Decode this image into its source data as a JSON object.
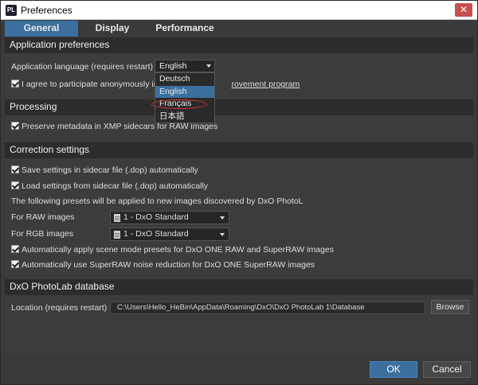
{
  "window": {
    "title": "Preferences",
    "app_icon": "PL",
    "close_symbol": "✕"
  },
  "tabs": [
    {
      "label": "General",
      "active": true
    },
    {
      "label": "Display",
      "active": false
    },
    {
      "label": "Performance",
      "active": false
    }
  ],
  "app_prefs": {
    "header": "Application preferences",
    "language_label": "Application language (requires restart)",
    "language_value": "English",
    "language_options": [
      "Deutsch",
      "English",
      "Français",
      "日本語"
    ],
    "participate_prefix": "I agree to participate anonymously in t",
    "participate_link": "rovement program"
  },
  "processing": {
    "header": "Processing",
    "preserve_metadata": "Preserve metadata in XMP sidecars for RAW images"
  },
  "correction": {
    "header": "Correction settings",
    "save_sidecar": "Save settings in sidecar file (.dop) automatically",
    "load_sidecar": "Load settings from sidecar file (.dop) automatically",
    "presets_note": "The following presets will be applied to new images discovered by DxO PhotoL",
    "raw_label": "For RAW images",
    "raw_value": "1 - DxO Standard",
    "rgb_label": "For RGB images",
    "rgb_value": "1 - DxO Standard",
    "scene_mode": "Automatically apply scene mode presets for DxO ONE RAW and SuperRAW images",
    "superraw": "Automatically use SuperRAW noise reduction for DxO ONE SuperRAW images"
  },
  "database": {
    "header": "DxO PhotoLab database",
    "location_label": "Location (requires restart)",
    "path": "C:\\Users\\Hello_HeBin\\AppData\\Roaming\\DxO\\DxO PhotoLab 1\\Database",
    "browse": "Browse"
  },
  "buttons": {
    "ok": "OK",
    "cancel": "Cancel"
  },
  "colors": {
    "accent": "#3b6f9e",
    "annotation": "#dd3333"
  }
}
